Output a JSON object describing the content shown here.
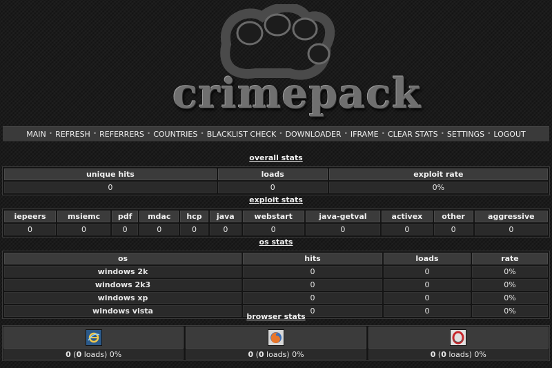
{
  "logo": {
    "text": "crimepack"
  },
  "nav": {
    "items": [
      "MAIN",
      "REFRESH",
      "REFERRERS",
      "COUNTRIES",
      "BLACKLIST CHECK",
      "DOWNLOADER",
      "IFRAME",
      "CLEAR STATS",
      "SETTINGS",
      "LOGOUT"
    ],
    "separator": "•"
  },
  "overall": {
    "title": "overall stats",
    "headers": [
      "unique hits",
      "loads",
      "exploit rate"
    ],
    "values": [
      "0",
      "0",
      "0%"
    ]
  },
  "exploit": {
    "title": "exploit stats",
    "headers": [
      "iepeers",
      "msiemc",
      "pdf",
      "mdac",
      "hcp",
      "java",
      "webstart",
      "java-getval",
      "activex",
      "other",
      "aggressive"
    ],
    "values": [
      "0",
      "0",
      "0",
      "0",
      "0",
      "0",
      "0",
      "0",
      "0",
      "0",
      "0"
    ]
  },
  "os": {
    "title": "os stats",
    "headers": [
      "os",
      "hits",
      "loads",
      "rate"
    ],
    "rows": [
      [
        "windows 2k",
        "0",
        "0",
        "0%"
      ],
      [
        "windows 2k3",
        "0",
        "0",
        "0%"
      ],
      [
        "windows xp",
        "0",
        "0",
        "0%"
      ],
      [
        "windows vista",
        "0",
        "0",
        "0%"
      ]
    ]
  },
  "browser": {
    "title": "browser stats",
    "items": [
      {
        "icon": "internet-explorer-icon",
        "hits": "0",
        "loads": "0",
        "loads_label": "loads",
        "rate": "0%"
      },
      {
        "icon": "firefox-icon",
        "hits": "0",
        "loads": "0",
        "loads_label": "loads",
        "rate": "0%"
      },
      {
        "icon": "opera-icon",
        "hits": "0",
        "loads": "0",
        "loads_label": "loads",
        "rate": "0%"
      }
    ]
  }
}
